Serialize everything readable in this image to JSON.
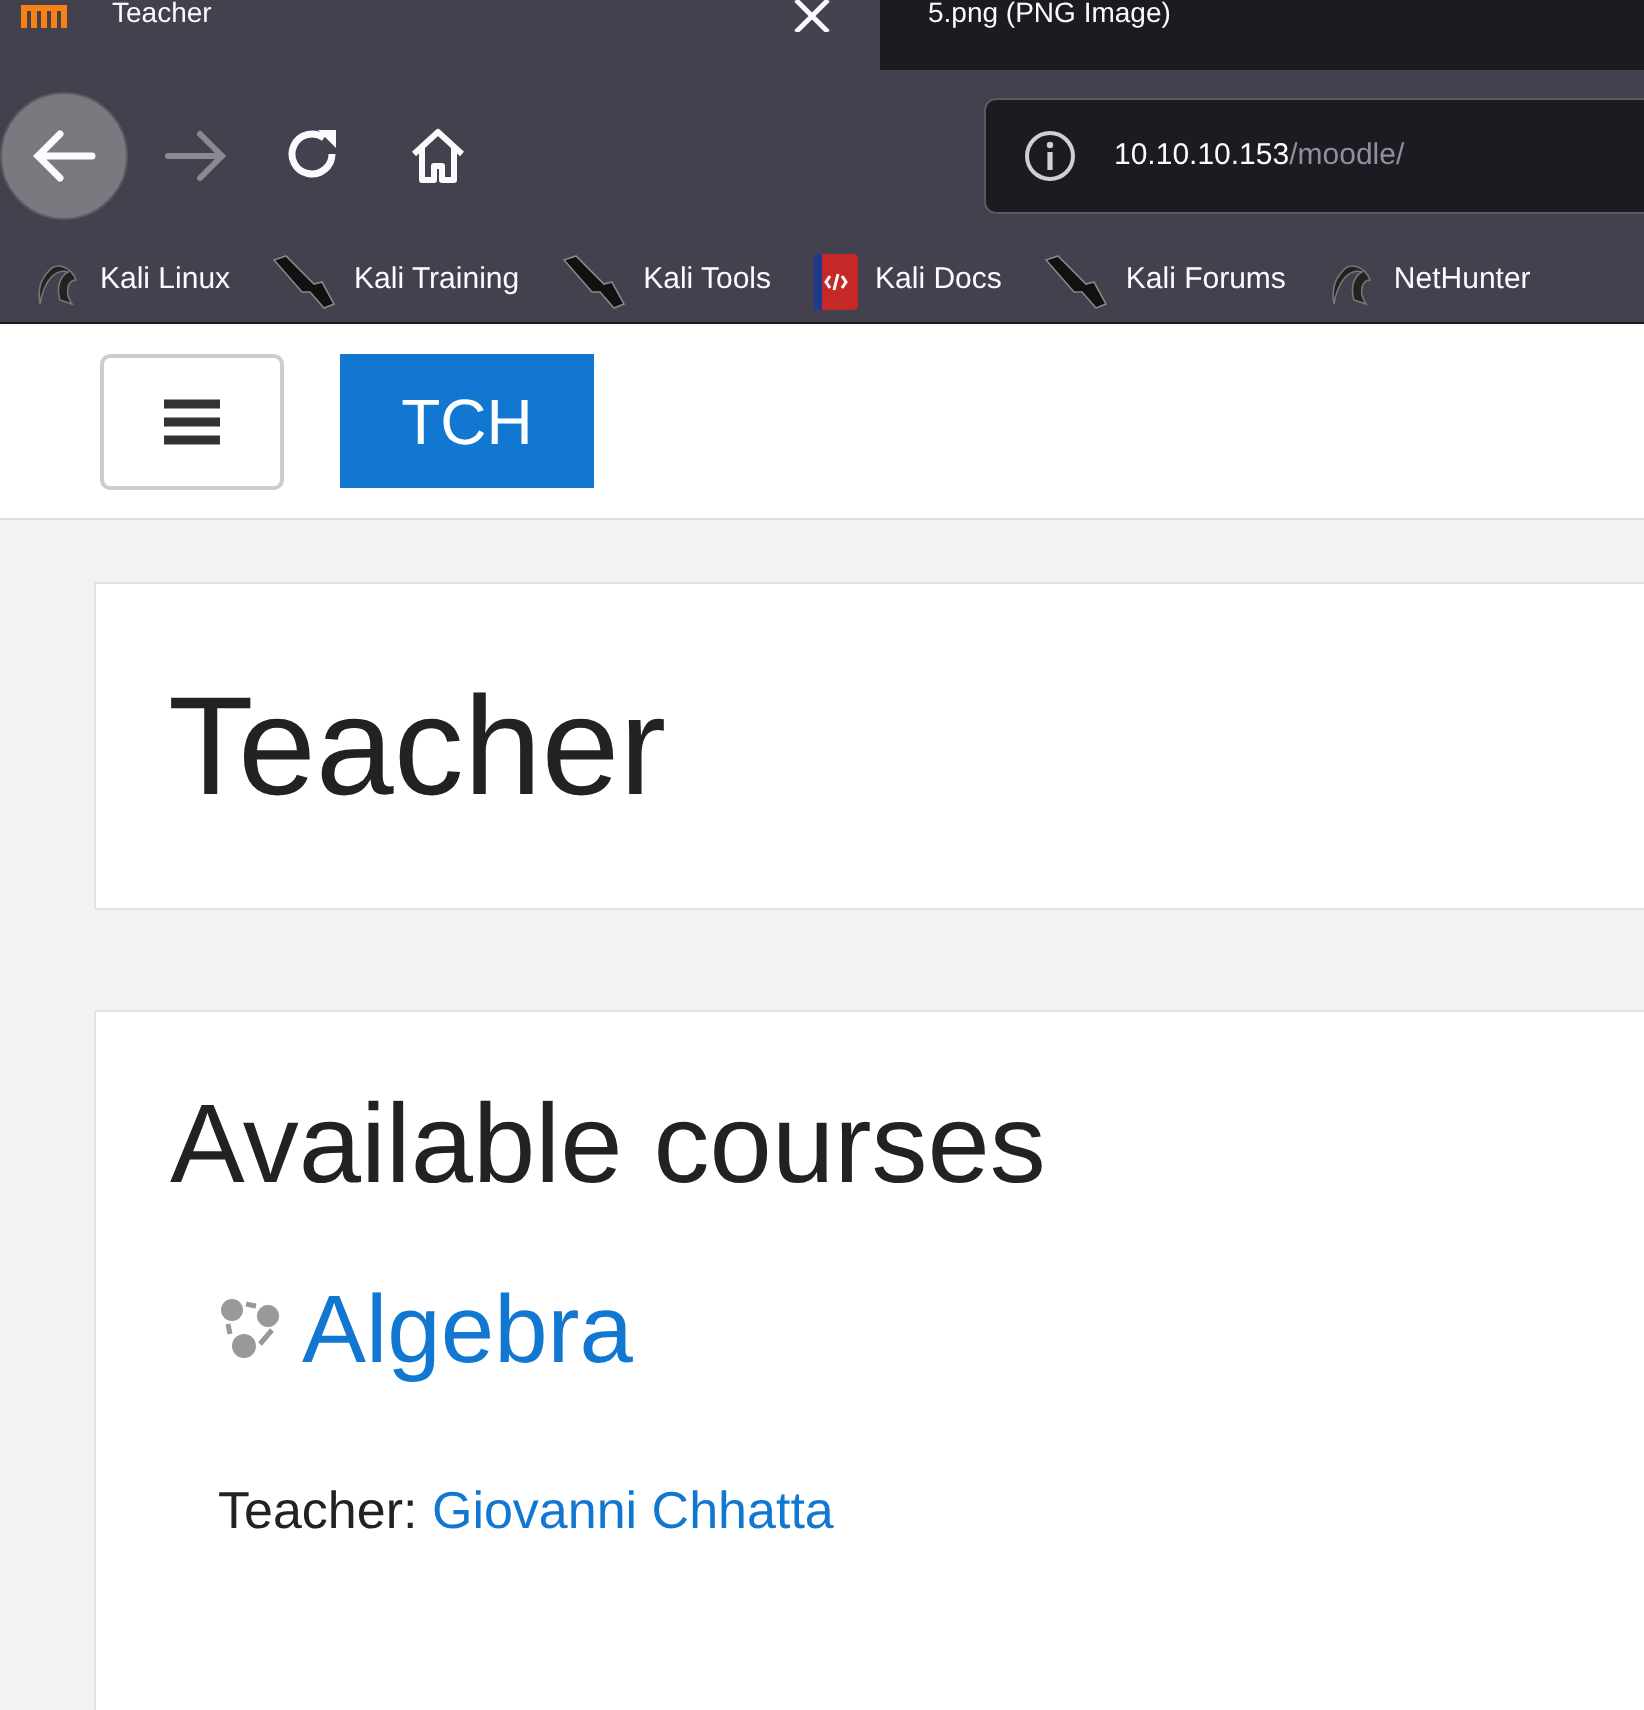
{
  "tabs": [
    {
      "title": "Teacher",
      "selected": true
    },
    {
      "title": "5.png (PNG Image)",
      "selected": false
    }
  ],
  "toolbar": {
    "back": {
      "disabled": false
    },
    "forward": {
      "disabled": true
    }
  },
  "address": {
    "host": "10.10.10.153",
    "path": "/moodle/"
  },
  "bookmarks": [
    {
      "label": "Kali Linux",
      "kind": "dragon"
    },
    {
      "label": "Kali Training",
      "kind": "knife"
    },
    {
      "label": "Kali Tools",
      "kind": "knife"
    },
    {
      "label": "Kali Docs",
      "kind": "book"
    },
    {
      "label": "Kali Forums",
      "kind": "knife"
    },
    {
      "label": "NetHunter",
      "kind": "dragon"
    }
  ],
  "header": {
    "logo": "TCH"
  },
  "site": {
    "title": "Teacher"
  },
  "courses": {
    "heading": "Available courses",
    "items": [
      {
        "name": "Algebra",
        "teacher_label": "Teacher:",
        "teacher": "Giovanni Chhatta"
      }
    ]
  }
}
